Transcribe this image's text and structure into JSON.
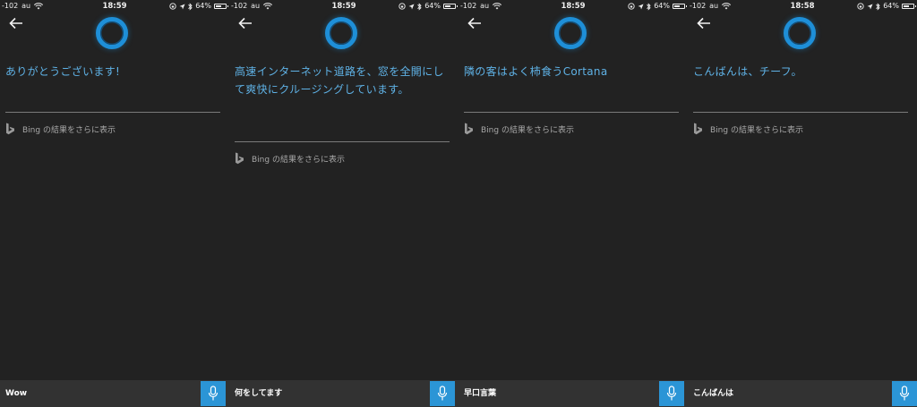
{
  "colors": {
    "background": "#222222",
    "accent": "#2b95d6",
    "response_text": "#5fb2e6",
    "input_bar": "#323232"
  },
  "bing_link_label": "Bing の結果をさらに表示",
  "screens": [
    {
      "status": {
        "signal": "-102",
        "carrier": "au",
        "time": "18:59",
        "battery": "64%",
        "battery_level": 0.64
      },
      "response": "ありがとうございます!",
      "query": "Wow"
    },
    {
      "status": {
        "signal": "-102",
        "carrier": "au",
        "time": "18:59",
        "battery": "64%",
        "battery_level": 0.64
      },
      "response": "高速インターネット道路を、窓を全開にして爽快にクルージングしています。",
      "query": "何をしてます"
    },
    {
      "status": {
        "signal": "-102",
        "carrier": "au",
        "time": "18:59",
        "battery": "64%",
        "battery_level": 0.64
      },
      "response": "隣の客はよく柿食うCortana",
      "query": "早口言葉"
    },
    {
      "status": {
        "signal": "-102",
        "carrier": "au",
        "time": "18:58",
        "battery": "64%",
        "battery_level": 0.64
      },
      "response": "こんばんは、チーフ。",
      "query": "こんばんは"
    }
  ]
}
